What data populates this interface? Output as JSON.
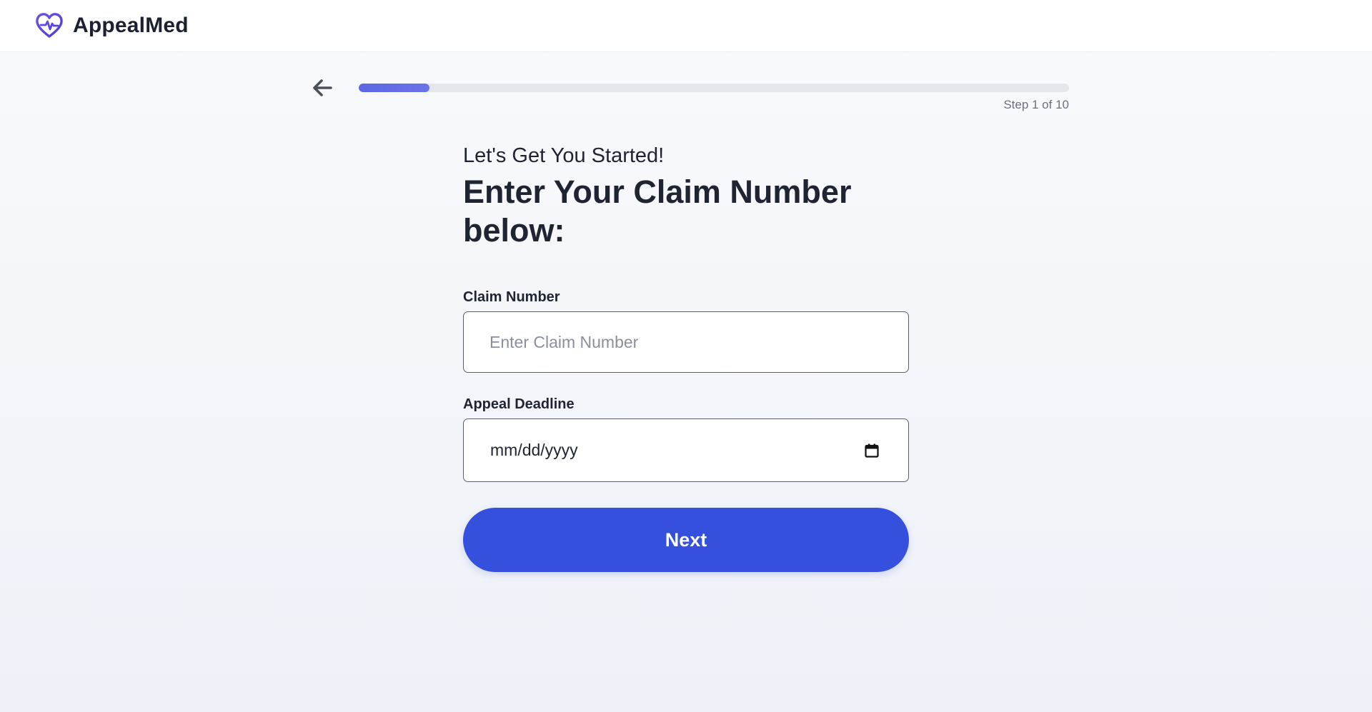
{
  "app": {
    "name": "AppealMed",
    "logo_icon": "heart-pulse-icon",
    "accent_color": "#5b4fe0"
  },
  "progress": {
    "back_icon": "arrow-left-icon",
    "value": 0.1,
    "step_text": "Step 1 of 10",
    "fill_color": "#5d67e3"
  },
  "form": {
    "subtitle": "Let's Get You Started!",
    "headline": "Enter Your Claim Number below:",
    "claim_number": {
      "label": "Claim Number",
      "placeholder": "Enter Claim Number",
      "value": ""
    },
    "appeal_deadline": {
      "label": "Appeal Deadline",
      "value": "mm/dd/yyyy",
      "icon": "calendar-icon"
    },
    "next_button": {
      "label": "Next",
      "color": "#3550dc"
    }
  }
}
